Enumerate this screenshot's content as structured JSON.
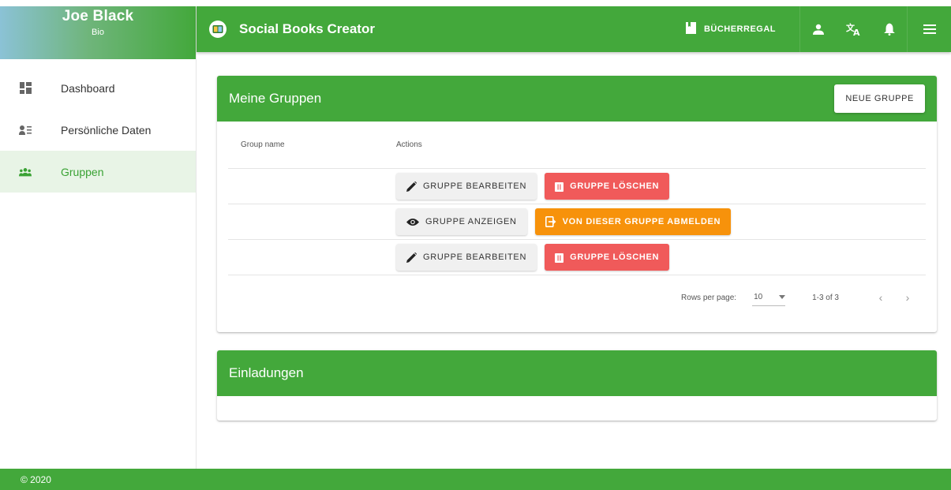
{
  "profile": {
    "name": "Joe Black",
    "role": "Bio"
  },
  "sidebar": {
    "items": [
      {
        "label": "Dashboard",
        "icon": "dashboard-icon"
      },
      {
        "label": "Persönliche Daten",
        "icon": "person-list-icon"
      },
      {
        "label": "Gruppen",
        "icon": "groups-icon",
        "active": true
      }
    ]
  },
  "appbar": {
    "title": "Social Books Creator",
    "bookshelf_label": "BÜCHERREGAL",
    "icons": [
      "book-icon",
      "person-icon",
      "translate-icon",
      "bell-icon",
      "menu-icon"
    ]
  },
  "groups_card": {
    "title": "Meine Gruppen",
    "new_button": "NEUE GRUPPE",
    "columns": {
      "name": "Group name",
      "actions": "Actions"
    },
    "rows": [
      {
        "name": "",
        "primary": "GRUPPE BEARBEITEN",
        "secondary": "GRUPPE LÖSCHEN"
      },
      {
        "name": "",
        "primary": "GRUPPE ANZEIGEN",
        "secondary": "VON DIESER GRUPPE ABMELDEN"
      },
      {
        "name": "",
        "primary": "GRUPPE BEARBEITEN",
        "secondary": "GRUPPE LÖSCHEN"
      }
    ],
    "pagination": {
      "rows_per_page_label": "Rows per page:",
      "rows_per_page": "10",
      "range": "1-3 of 3",
      "prev": "‹",
      "next": "›"
    }
  },
  "invites_card": {
    "title": "Einladungen"
  },
  "footer": {
    "text": "© 2020"
  },
  "colors": {
    "primary_green": "#43a83b",
    "delete_red": "#f05a5a",
    "leave_orange": "#f7920b",
    "active_bg": "#e8f4e6"
  }
}
